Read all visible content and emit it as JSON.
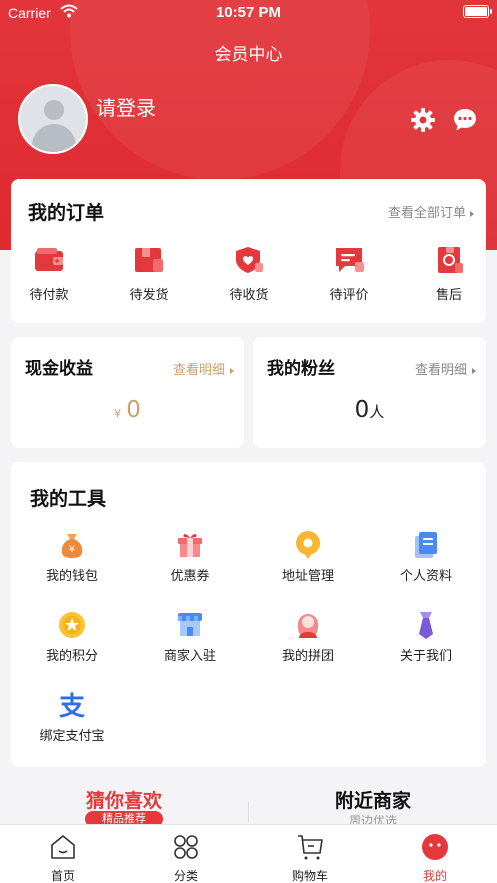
{
  "status_bar": {
    "carrier": "Carrier",
    "time": "10:57 PM"
  },
  "nav": {
    "title": "会员中心"
  },
  "profile": {
    "login_text": "请登录"
  },
  "orders": {
    "title": "我的订单",
    "view_all": "查看全部订单",
    "items": [
      {
        "label": "待付款",
        "icon": "wallet-icon"
      },
      {
        "label": "待发货",
        "icon": "package-icon"
      },
      {
        "label": "待收货",
        "icon": "shield-heart-icon"
      },
      {
        "label": "待评价",
        "icon": "comment-icon"
      },
      {
        "label": "售后",
        "icon": "refund-icon"
      }
    ]
  },
  "cash": {
    "title": "现金收益",
    "link": "查看明细",
    "currency": "¥",
    "value": "0"
  },
  "fans": {
    "title": "我的粉丝",
    "link": "查看明细",
    "value": "0",
    "unit": "人"
  },
  "tools": {
    "title": "我的工具",
    "items": [
      {
        "label": "我的钱包",
        "icon": "money-bag-icon"
      },
      {
        "label": "优惠券",
        "icon": "gift-box-icon"
      },
      {
        "label": "地址管理",
        "icon": "location-icon"
      },
      {
        "label": "个人资料",
        "icon": "document-icon"
      },
      {
        "label": "我的积分",
        "icon": "star-coin-icon"
      },
      {
        "label": "商家入驻",
        "icon": "store-icon"
      },
      {
        "label": "我的拼团",
        "icon": "group-icon"
      },
      {
        "label": "关于我们",
        "icon": "tie-icon"
      },
      {
        "label": "绑定支付宝",
        "icon": "alipay-icon"
      }
    ]
  },
  "feed_tabs": {
    "guess": {
      "label": "猜你喜欢",
      "sub": "精品推荐"
    },
    "nearby": {
      "label": "附近商家",
      "sub": "周边优选"
    }
  },
  "tabbar": {
    "items": [
      {
        "label": "首页"
      },
      {
        "label": "分类"
      },
      {
        "label": "购物车"
      },
      {
        "label": "我的"
      }
    ]
  },
  "colors": {
    "brand_red": "#e4393c",
    "gold": "#c8a16b"
  }
}
